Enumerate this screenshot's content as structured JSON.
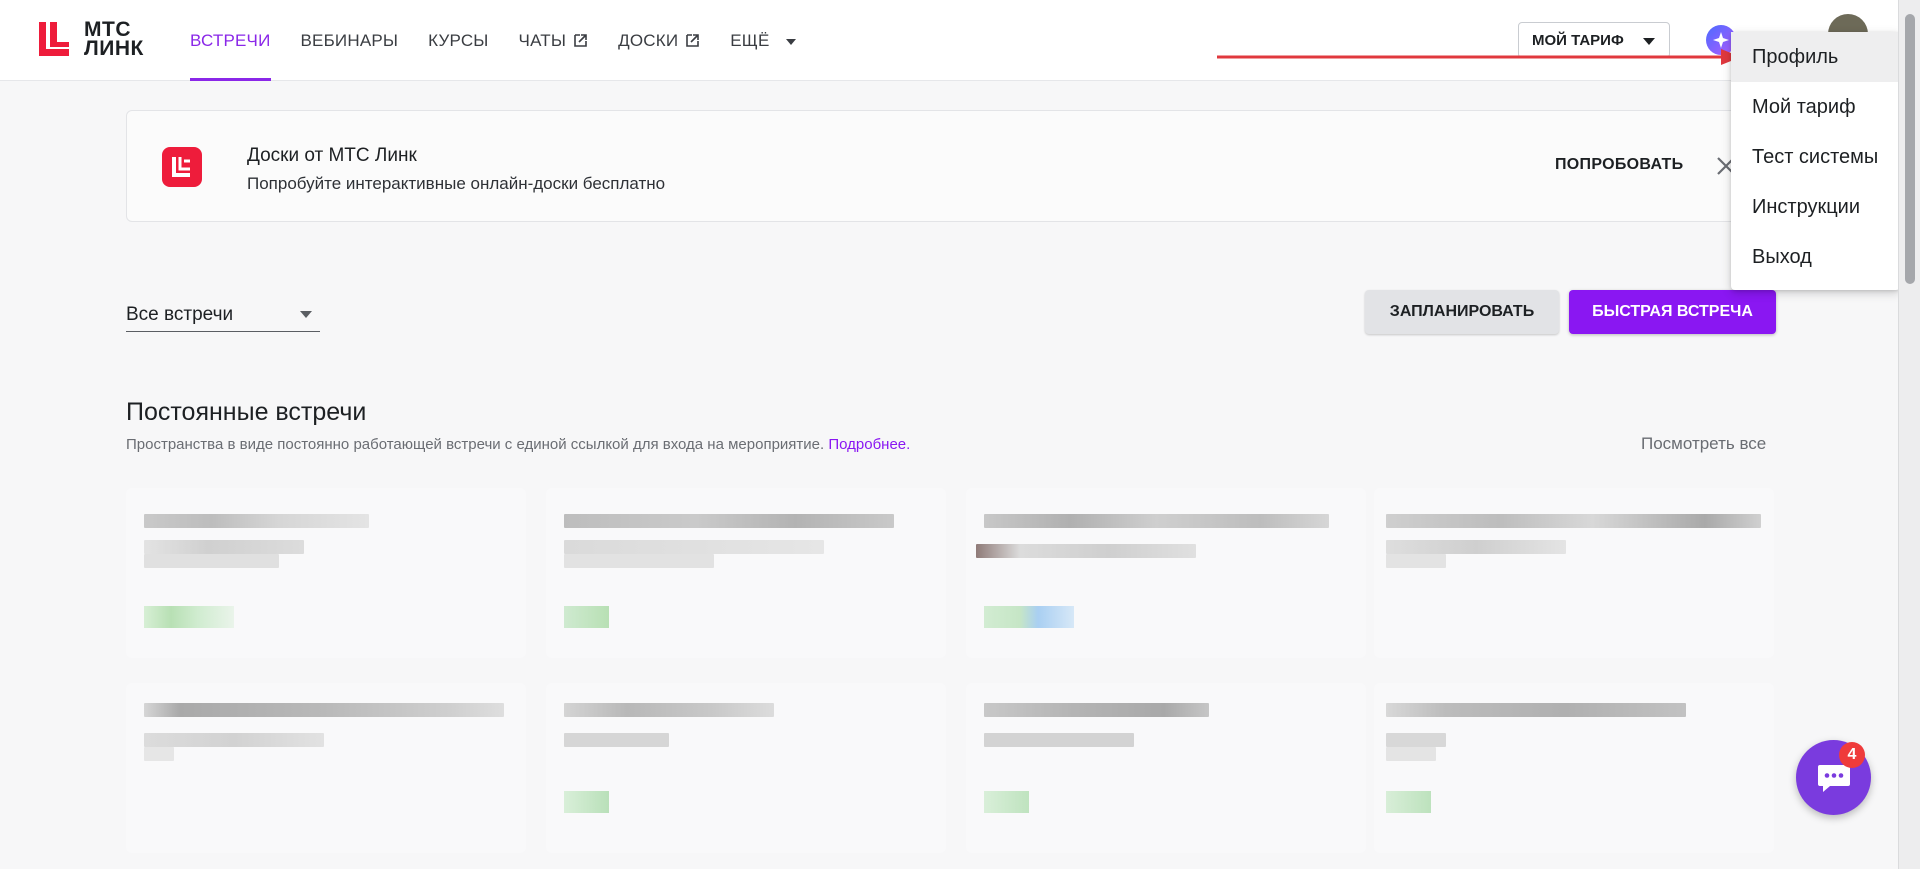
{
  "header": {
    "logo_text_line1": "МТС",
    "logo_text_line2": "ЛИНК",
    "nav": [
      {
        "label": "ВСТРЕЧИ",
        "active": true
      },
      {
        "label": "ВЕБИНАРЫ"
      },
      {
        "label": "КУРСЫ"
      },
      {
        "label": "ЧАТЫ",
        "external": true
      },
      {
        "label": "ДОСКИ",
        "external": true
      },
      {
        "label": "ЕЩЁ",
        "dropdown": true
      }
    ],
    "tariff_select": "МОЙ ТАРИФ"
  },
  "banner": {
    "title": "Доски от МТС Линк",
    "subtitle": "Попробуйте интерактивные онлайн-доски бесплатно",
    "try_label": "ПОПРОБОВАТЬ"
  },
  "controls": {
    "filter_value": "Все встречи",
    "schedule_label": "ЗАПЛАНИРОВАТЬ",
    "quick_meeting_label": "БЫСТРАЯ ВСТРЕЧА"
  },
  "permanent": {
    "title": "Постоянные встречи",
    "description": "Пространства в виде постоянно работающей встречи с единой ссылкой для входа на мероприятие.",
    "more_link": "Подробнее.",
    "view_all": "Посмотреть все"
  },
  "profile_menu": {
    "items": [
      "Профиль",
      "Мой тариф",
      "Тест системы",
      "Инструкции",
      "Выход"
    ]
  },
  "chat": {
    "badge_count": "4"
  },
  "colors": {
    "accent": "#8a17f2",
    "brand_red": "#ee1c3b",
    "annotation_arrow": "#e0383e"
  }
}
